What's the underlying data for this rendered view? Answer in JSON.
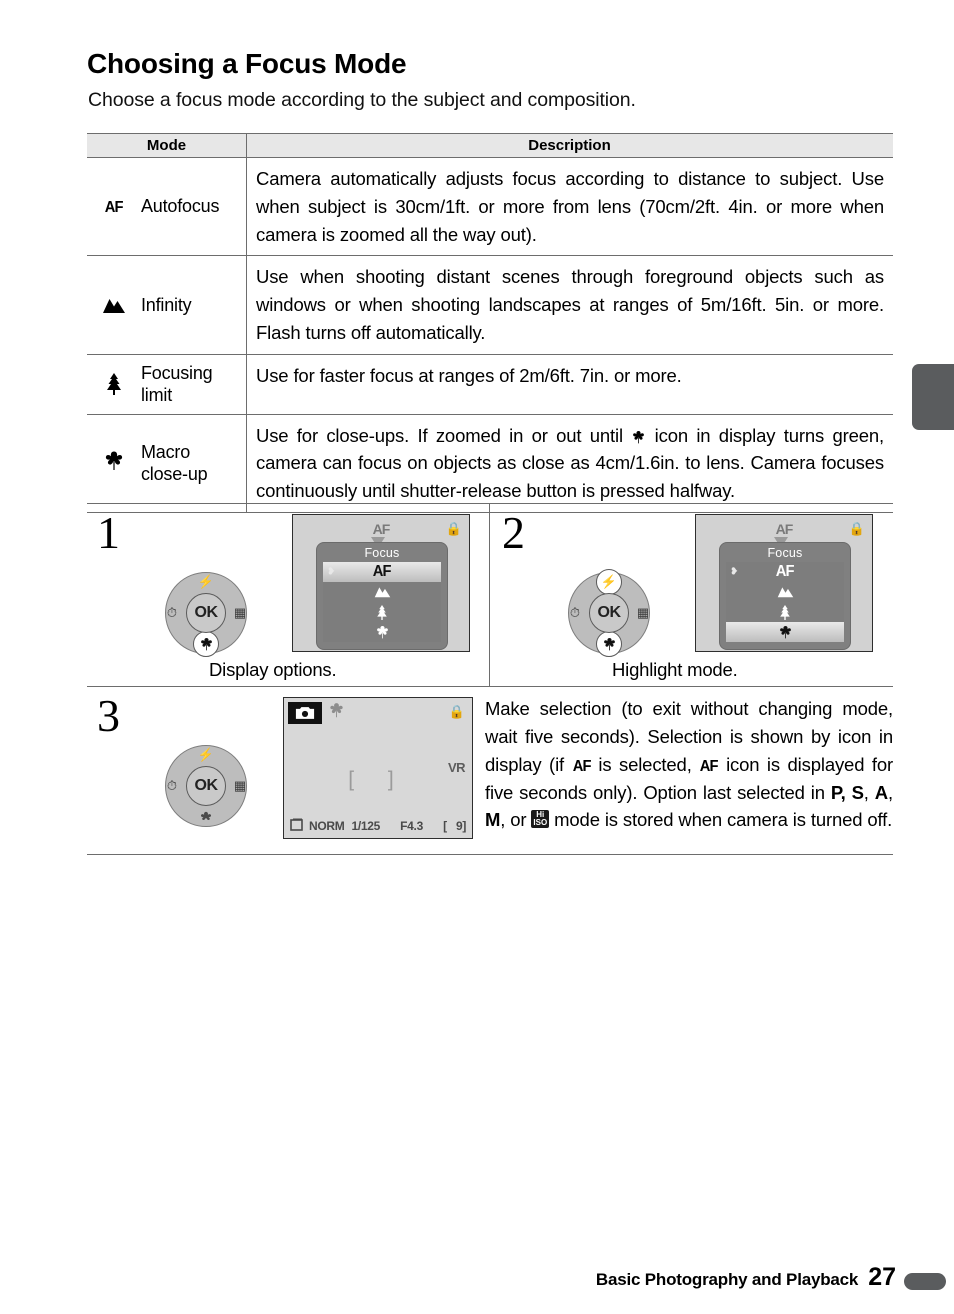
{
  "heading": "Choosing a Focus Mode",
  "subheading": "Choose a focus mode according to the subject and composition.",
  "table": {
    "columns": {
      "mode": "Mode",
      "description": "Description"
    },
    "rows": [
      {
        "icon": "af-icon",
        "icon_text": "AF",
        "label": "Autofocus",
        "description": "Camera automatically adjusts focus according to distance to subject. Use when subject is 30cm/1ft. or more from lens (70cm/2ft. 4in. or more when camera is zoomed all the way out)."
      },
      {
        "icon": "mountains-infinity-icon",
        "icon_text": "",
        "label": "Infinity",
        "description": "Use when shooting distant scenes through foreground objects such as windows or when shooting landscapes at ranges of 5m/16ft. 5in. or more. Flash turns off automatically."
      },
      {
        "icon": "tree-focusing-limit-icon",
        "icon_text": "",
        "label": "Focusing limit",
        "description": "Use for faster focus at ranges of 2m/6ft. 7in. or more."
      },
      {
        "icon": "flower-macro-icon",
        "icon_text": "",
        "label": "Macro close-up",
        "description_parts": [
          "Use for close-ups.  If zoomed in or out until ",
          " icon in display turns green, camera can focus on objects as close as 4cm/1.6in. to lens. Camera focuses continuously until shutter-release button is pressed halfway."
        ]
      }
    ]
  },
  "steps": [
    {
      "number": "1",
      "caption": "Display options.",
      "selector": {
        "ok_label": "OK",
        "highlight": [
          "bottom"
        ]
      },
      "lcd": {
        "top_indicator": "AF",
        "lock_indicator": "protect-icon",
        "menu_title": "Focus",
        "items": [
          "AF",
          "infinity",
          "focus-limit",
          "macro"
        ],
        "selected_index": 0
      }
    },
    {
      "number": "2",
      "caption": "Highlight mode.",
      "selector": {
        "ok_label": "OK",
        "highlight": [
          "top",
          "bottom"
        ]
      },
      "lcd": {
        "top_indicator": "AF",
        "lock_indicator": "protect-icon",
        "menu_title": "Focus",
        "items": [
          "AF",
          "infinity",
          "focus-limit",
          "macro"
        ],
        "selected_index": 3
      }
    }
  ],
  "step3": {
    "number": "3",
    "selector": {
      "ok_label": "OK",
      "highlight": []
    },
    "lcd": {
      "mode_icon": "camera-icon",
      "macro_icon": "flower-macro-icon",
      "lock_indicator": "protect-icon",
      "vr": "VR",
      "focus_brackets": "[  ]",
      "status": {
        "image_size_icon": "image-size-icon",
        "quality": "NORM",
        "shutter_speed": "1/125",
        "aperture": "F4.3",
        "frames_remaining": "9"
      }
    },
    "text_parts": [
      "Make selection (to exit without changing mode, wait five seconds).  Selection is shown by icon in display (if ",
      " is selected, ",
      " icon is displayed for five seconds only). Option last selected in ",
      "P, S",
      ", ",
      "A",
      ", ",
      "M",
      ", or ",
      " mode is stored when camera is turned off."
    ],
    "af_token": "AF",
    "iso_badge": {
      "top": "Hi",
      "bottom": "ISO"
    }
  },
  "footer": {
    "section": "Basic Photography and Playback",
    "page": "27"
  }
}
